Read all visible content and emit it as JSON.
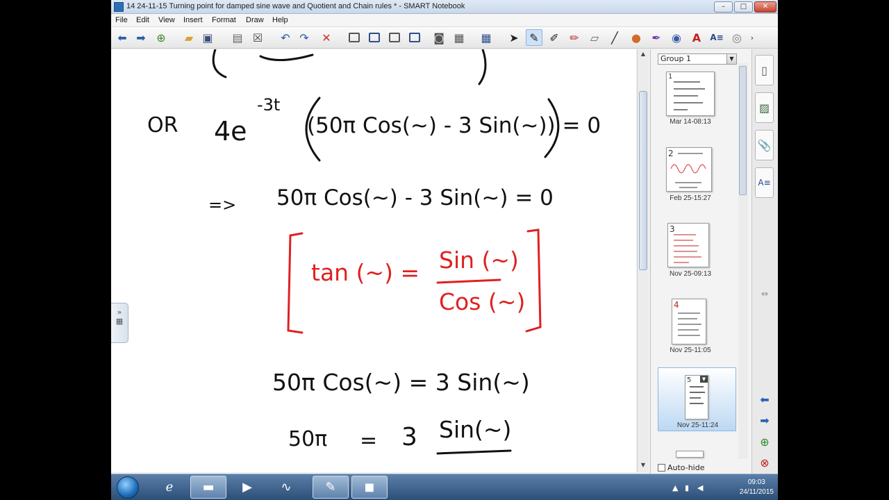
{
  "window": {
    "title": "14 24-11-15 Turning point for damped sine wave and Quotient and Chain rules * - SMART Notebook"
  },
  "menu": [
    "File",
    "Edit",
    "View",
    "Insert",
    "Format",
    "Draw",
    "Help"
  ],
  "canvas": {
    "line1_or": "OR",
    "line1_coef": "4e",
    "line1_exp": "-3t",
    "line1_body": "(50π Cos(~) - 3 Sin(~)) = 0",
    "line2_implies": "=>",
    "line2_body": "50π Cos(~) - 3 Sin(~) = 0",
    "box_lhs": "tan (~) =",
    "box_num": "Sin (~)",
    "box_den": "Cos (~)",
    "line3_body": "50π Cos(~) = 3 Sin(~)",
    "line4_lhs": "50π",
    "line4_eq": "=",
    "line4_three": "3",
    "line4_num": "Sin(~)"
  },
  "sorter": {
    "group_label": "Group 1",
    "pages": [
      {
        "num": "1",
        "label": "Mar 14-08:13"
      },
      {
        "num": "2",
        "label": "Feb 25-15:27"
      },
      {
        "num": "3",
        "label": "Nov 25-09:13"
      },
      {
        "num": "4",
        "label": "Nov 25-11:05"
      },
      {
        "num": "5",
        "label": "Nov 25-11:24"
      }
    ],
    "auto_hide": "Auto-hide"
  },
  "taskbar": {
    "time": "09:03",
    "date": "24/11/2015"
  },
  "colors": {
    "ink": "#111111",
    "red_ink": "#e02020",
    "accent": "#2a64b0"
  }
}
